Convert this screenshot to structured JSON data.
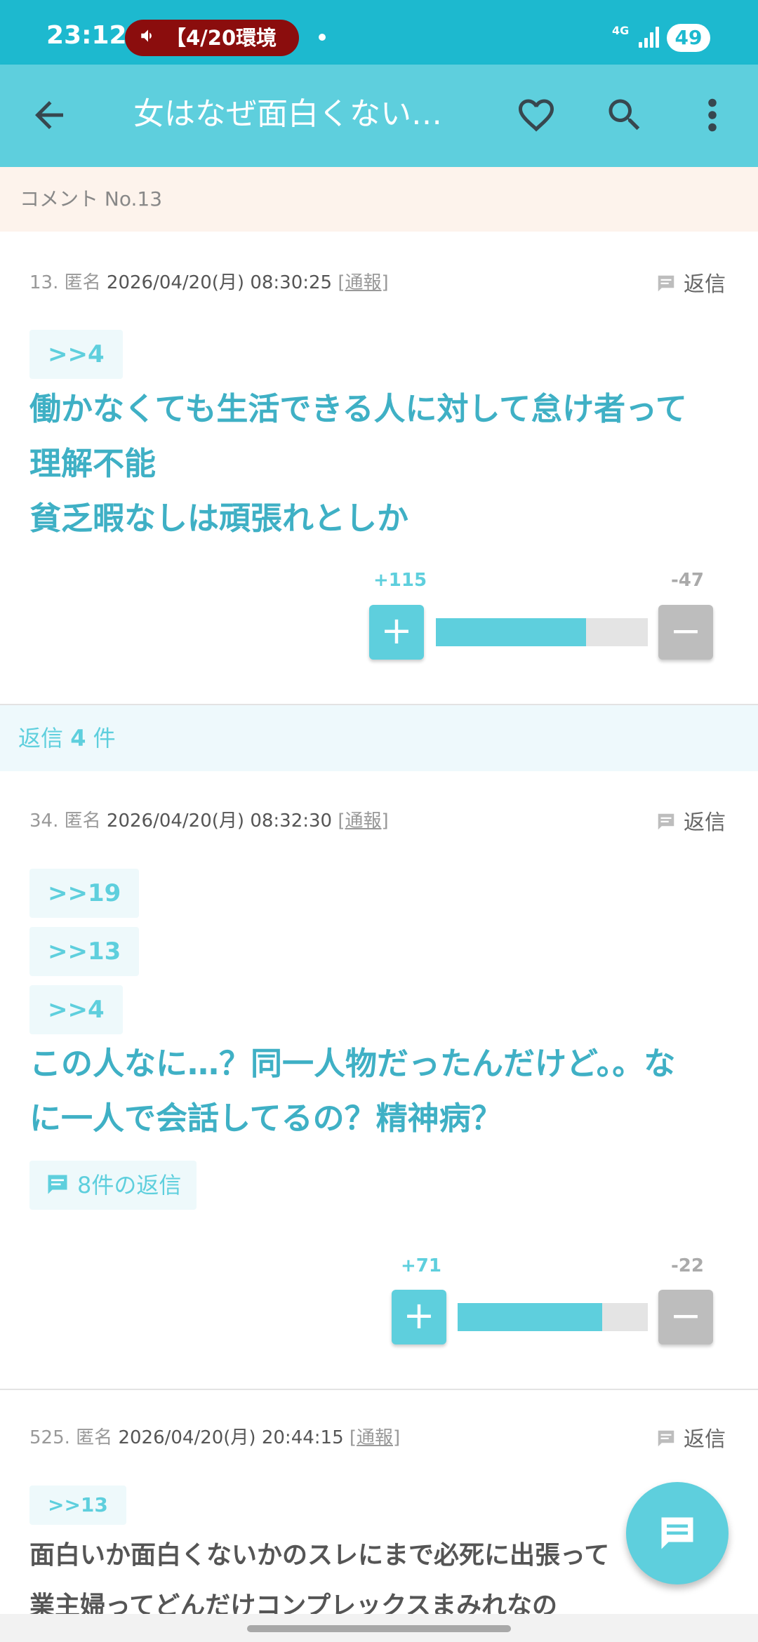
{
  "status": {
    "time": "23:12",
    "media_label": "【4/20環境",
    "network": "4G",
    "battery": "49"
  },
  "app_bar": {
    "title": "女はなぜ面白くない…"
  },
  "comment_header": "コメント No.13",
  "post1": {
    "number": "13.",
    "name": "匿名",
    "date": "2026/04/20(月) 08:30:25",
    "report": "[通報]",
    "reply_label": "返信",
    "anchors": [
      ">>4"
    ],
    "lines": [
      "働かなくても生活できる人に対して怠け者って",
      "理解不能",
      "貧乏暇なしは頑張れとしか"
    ],
    "plus": "+115",
    "minus": "-47",
    "plus_ratio": 0.71,
    "plus_symbol": "+",
    "minus_symbol": "−"
  },
  "reply_band": {
    "prefix": "返信",
    "count": "4",
    "suffix": "件"
  },
  "post2": {
    "number": "34.",
    "name": "匿名",
    "date": "2026/04/20(月) 08:32:30",
    "report": "[通報]",
    "reply_label": "返信",
    "anchors": [
      ">>19",
      ">>13",
      ">>4"
    ],
    "lines": [
      "この人なに…？同一人物だったんだけど。。な",
      "に一人で会話してるの？精神病？"
    ],
    "replies_chip": "8件の返信",
    "plus": "+71",
    "minus": "-22",
    "plus_ratio": 0.76,
    "plus_symbol": "+",
    "minus_symbol": "−"
  },
  "post3": {
    "number": "525.",
    "name": "匿名",
    "date": "2026/04/20(月) 20:44:15",
    "report": "[通報]",
    "reply_label": "返信",
    "anchors": [
      ">>13"
    ],
    "lines": [
      "面白いか面白くないかのスレにまで必死に出張って",
      "業主婦ってどんだけコンプレックスまみれなの"
    ]
  },
  "colors": {
    "accent": "#5ecfdd",
    "status_bar": "#1db9cf",
    "body_text": "#3fb0c5"
  },
  "icons": {
    "back": "arrow-left-icon",
    "favorite": "heart-outline-icon",
    "search": "search-icon",
    "more": "more-vert-icon",
    "reply": "comment-icon",
    "fab": "comment-icon"
  }
}
